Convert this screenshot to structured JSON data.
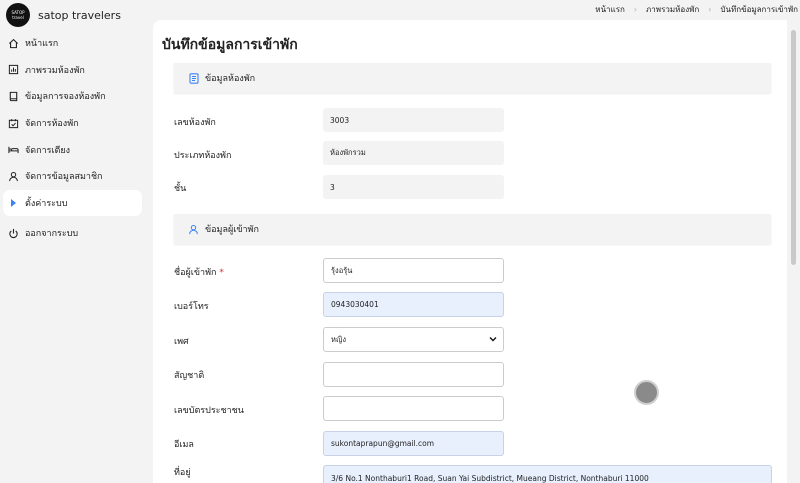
{
  "app": {
    "name": "satop travelers",
    "logo_line1": "SATOP",
    "logo_line2": "travel"
  },
  "breadcrumb": [
    "หน้าแรก",
    "ภาพรวมห้องพัก",
    "บันทึกข้อมูลการเข้าพัก"
  ],
  "sidebar": {
    "items": [
      {
        "label": "หน้าแรก",
        "icon": "home-icon"
      },
      {
        "label": "ภาพรวมห้องพัก",
        "icon": "chart-icon"
      },
      {
        "label": "ข้อมูลการจองห้องพัก",
        "icon": "book-icon"
      },
      {
        "label": "จัดการห้องพัก",
        "icon": "calendar-check-icon"
      },
      {
        "label": "จัดการเตียง",
        "icon": "bed-icon"
      },
      {
        "label": "จัดการข้อมูลสมาชิก",
        "icon": "user-icon"
      },
      {
        "label": "ตั้งค่าระบบ",
        "icon": "caret-right-icon"
      }
    ],
    "logout": {
      "label": "ออกจากระบบ",
      "icon": "power-icon"
    }
  },
  "page": {
    "title": "บันทึกข้อมูลการเข้าพัก"
  },
  "room_section": {
    "heading": "ข้อมูลห้องพัก",
    "fields": [
      {
        "label": "เลขห้องพัก",
        "value": "3003"
      },
      {
        "label": "ประเภทห้องพัก",
        "value": "ห้องพักรวม"
      },
      {
        "label": "ชั้น",
        "value": "3"
      }
    ]
  },
  "guest_section": {
    "heading": "ข้อมูลผู้เข้าพัก",
    "name": {
      "label": "ชื่อผู้เข้าพัก",
      "required_mark": "*",
      "value": "รุ้งอรุ้น"
    },
    "phone": {
      "label": "เบอร์โทร",
      "value": "0943030401"
    },
    "gender": {
      "label": "เพศ",
      "value": "หญิง"
    },
    "nationality": {
      "label": "สัญชาติ",
      "value": ""
    },
    "id_card": {
      "label": "เลขบัตรประชาชน",
      "value": ""
    },
    "email": {
      "label": "อีเมล",
      "value": "sukontaprapun@gmail.com"
    },
    "address": {
      "label": "ที่อยู่",
      "value": "3/6 No.1 Nonthaburi1 Road, Suan Yai Subdistrict, Mueang District, Nonthaburi 11000"
    }
  },
  "colors": {
    "accent": "#3b82f6",
    "required": "#d32f2f",
    "autofill": "#e8f0fe"
  }
}
